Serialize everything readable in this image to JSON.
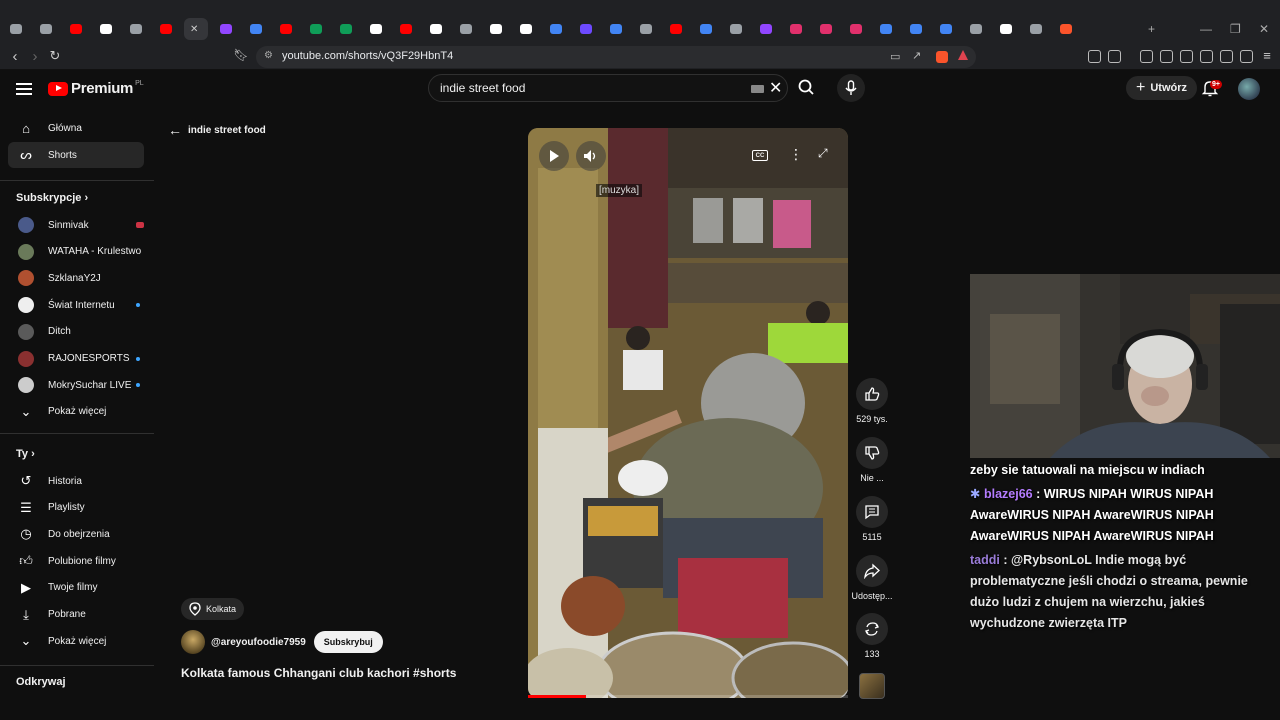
{
  "browser": {
    "url": "youtube.com/shorts/vQ3F29HbnT4",
    "tabs": [
      "tab",
      "tab",
      "youtube",
      "x",
      "tab",
      "youtube",
      "active",
      "twitch",
      "google",
      "youtube",
      "sheets",
      "sheets",
      "x",
      "youtube",
      "x",
      "settings",
      "x",
      "notion",
      "google",
      "proton",
      "calendar",
      "tab",
      "youtube",
      "translate",
      "tab",
      "twitch",
      "instagram",
      "instagram",
      "instagram",
      "google",
      "google",
      "google",
      "tab",
      "x",
      "tab",
      "brave"
    ]
  },
  "header": {
    "logo_text": "Premium",
    "logo_sup": "PL",
    "search_value": "indie street food",
    "create_label": "Utwórz",
    "notif_badge": "9+"
  },
  "sidebar": {
    "main": [
      {
        "label": "Główna",
        "icon": "home-icon"
      },
      {
        "label": "Shorts",
        "icon": "shorts-icon"
      }
    ],
    "subs_title": "Subskrypcje",
    "subscriptions": [
      {
        "label": "Sinmivak",
        "color": "#4a5a8a",
        "live": "red"
      },
      {
        "label": "WATAHA - Krulestwo",
        "color": "#6a7a5a",
        "live": ""
      },
      {
        "label": "SzklanaY2J",
        "color": "#b05030",
        "live": ""
      },
      {
        "label": "Świat Internetu",
        "color": "#eeeeee",
        "live": "blue"
      },
      {
        "label": "Ditch",
        "color": "#5a5a5a",
        "live": ""
      },
      {
        "label": "RAJONESPORTS",
        "color": "#8a3030",
        "live": "blue"
      },
      {
        "label": "MokrySuchar LIVE",
        "color": "#cccccc",
        "live": "blue"
      },
      {
        "label": "Pokaż więcej",
        "color": "",
        "live": ""
      }
    ],
    "you_title": "Ty",
    "you_items": [
      {
        "label": "Historia",
        "icon": "history-icon"
      },
      {
        "label": "Playlisty",
        "icon": "playlist-icon"
      },
      {
        "label": "Do obejrzenia",
        "icon": "watch-later-icon"
      },
      {
        "label": "Polubione filmy",
        "icon": "like-icon"
      },
      {
        "label": "Twoje filmy",
        "icon": "your-videos-icon"
      },
      {
        "label": "Pobrane",
        "icon": "download-icon"
      },
      {
        "label": "Pokaż więcej",
        "icon": "chevron-down-icon"
      }
    ],
    "explore_title": "Odkrywaj"
  },
  "short": {
    "back_label": "indie street food",
    "caption": "[muzyka]",
    "location": "Kolkata",
    "channel": "@areyoufoodie7959",
    "subscribe_label": "Subskrybuj",
    "title": "Kolkata famous Chhangani club kachori #shorts",
    "progress": 0.18,
    "actions": {
      "likes": "529 tys.",
      "dislike": "Nie ...",
      "comments": "5115",
      "share": "Udostęp...",
      "remix": "133"
    }
  },
  "stream_overlay": {
    "chat": [
      {
        "user": "",
        "text": "zeby sie tatuowali na miejscu w indiach"
      },
      {
        "user": "blazej66",
        "text": ": WIRUS NIPAH  WIRUS NIPAH  AwareWIRUS NIPAH  AwareWIRUS NIPAH  AwareWIRUS NIPAH  AwareWIRUS NIPAH"
      },
      {
        "user": "taddi",
        "text": ": @RybsonLoL Indie mogą być problematyczne jeśli chodzi o streama, pewnie dużo ludzi z chujem na wierzchu, jakieś wychudzone zwierzęta ITP"
      }
    ]
  }
}
